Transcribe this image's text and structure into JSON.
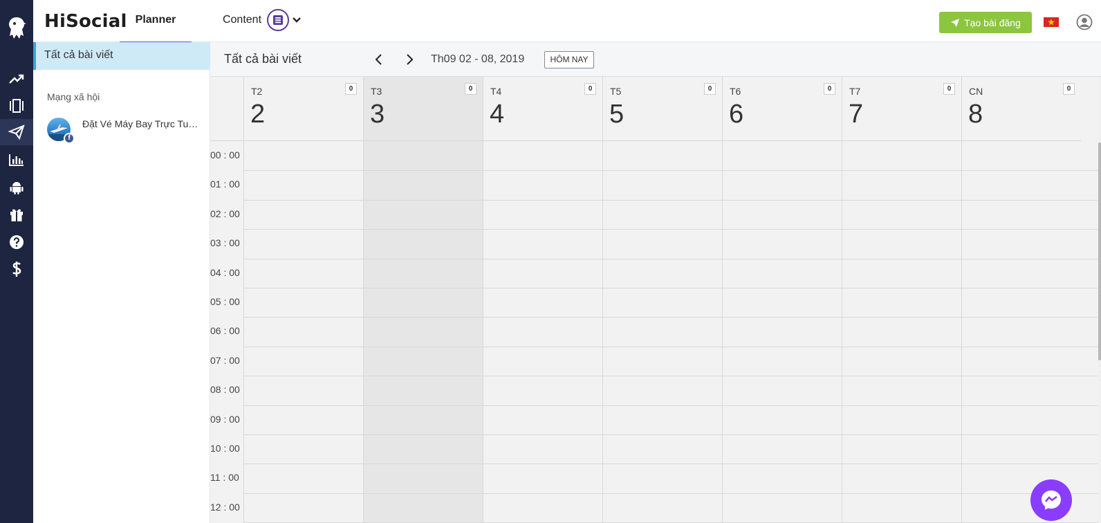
{
  "app": {
    "brand": "HiSocial"
  },
  "nav": {
    "tabs": [
      {
        "label": "Planner",
        "active": true
      },
      {
        "label": "Content",
        "active": false
      }
    ],
    "create_label": "Tạo bài đăng"
  },
  "rail": {
    "icons": [
      "chart-trend-icon",
      "carousel-icon",
      "send-icon",
      "bar-chart-icon",
      "android-icon",
      "gift-icon",
      "help-icon",
      "dollar-icon"
    ],
    "active_index": 2
  },
  "sidebar": {
    "all_posts": "Tất cả bài viết",
    "social_label": "Mạng xã hội",
    "pages": [
      {
        "name": "Đặt Vé Máy Bay Trực Tuyến",
        "network": "facebook"
      }
    ]
  },
  "calendar": {
    "title": "Tất cả bài viết",
    "range": "Th09 02 - 08, 2019",
    "today_label": "HÔM NAY",
    "days": [
      {
        "dow": "T2",
        "date": "2",
        "count": "0",
        "today": false
      },
      {
        "dow": "T3",
        "date": "3",
        "count": "0",
        "today": true
      },
      {
        "dow": "T4",
        "date": "4",
        "count": "0",
        "today": false
      },
      {
        "dow": "T5",
        "date": "5",
        "count": "0",
        "today": false
      },
      {
        "dow": "T6",
        "date": "6",
        "count": "0",
        "today": false
      },
      {
        "dow": "T7",
        "date": "7",
        "count": "0",
        "today": false
      },
      {
        "dow": "CN",
        "date": "8",
        "count": "0",
        "today": false
      }
    ],
    "hours": [
      "00 : 00",
      "01 : 00",
      "02 : 00",
      "03 : 00",
      "04 : 00",
      "05 : 00",
      "06 : 00",
      "07 : 00",
      "08 : 00",
      "09 : 00",
      "10 : 00",
      "11 : 00",
      "12 : 00"
    ]
  },
  "colors": {
    "rail_bg": "#1d2540",
    "accent": "#5b5fe0",
    "create_button": "#8cc63f",
    "selected_bg": "#cfeaf7",
    "messenger": "#8a3dff"
  }
}
